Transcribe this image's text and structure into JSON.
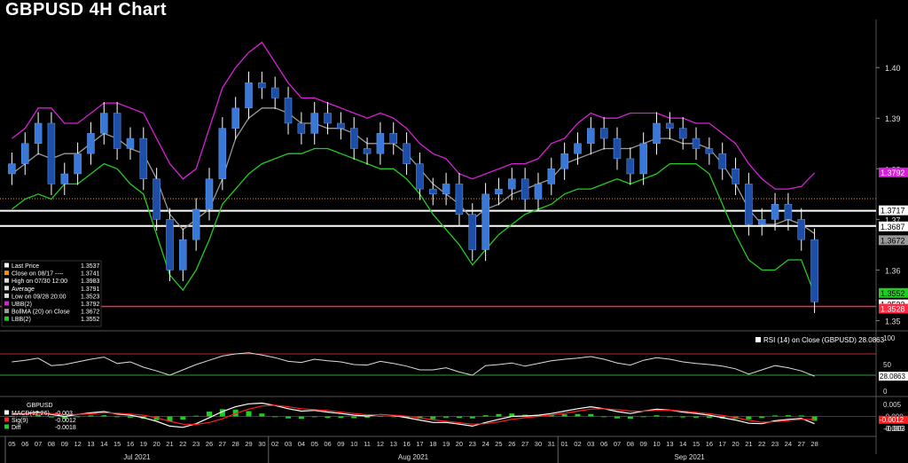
{
  "title": "GBPUSD 4H Chart",
  "colors": {
    "price_up": "#3a78d8",
    "price_wick": "#ffffff",
    "ubb": "#d81fd8",
    "lbb": "#22cc22",
    "bollma": "#9a9a9a",
    "resistance": "#ffffff",
    "support": "#ff2b44",
    "dotted": "#ff8c00",
    "rsi": "#dddddd",
    "macd": "#ffffff",
    "signal": "#ff2020",
    "diff": "#22cc22"
  },
  "legend": [
    {
      "label": "Last Price",
      "value": "1.3537",
      "color": "#ffffff"
    },
    {
      "label": "Close on 08/17 ----",
      "value": "1.3741",
      "color": "#ff8c00"
    },
    {
      "label": "High on 07/30 12:00",
      "value": "1.3983",
      "color": "#dddddd"
    },
    {
      "label": "Average",
      "value": "1.3791",
      "color": "#dddddd"
    },
    {
      "label": "Low on 09/28 20:00",
      "value": "1.3523",
      "color": "#dddddd"
    },
    {
      "label": "UBB(2)",
      "value": "1.3792",
      "color": "#d81fd8"
    },
    {
      "label": "BollMA (20)  on Close",
      "value": "1.3672",
      "color": "#9a9a9a"
    },
    {
      "label": "LBB(2)",
      "value": "1.3552",
      "color": "#22cc22"
    }
  ],
  "price_axis": {
    "ticks": [
      "1.40",
      "1.39",
      "1.38",
      "1.37",
      "1.36",
      "1.35"
    ]
  },
  "price_tags": [
    {
      "text": "1.3792",
      "bg": "#d81fd8",
      "fg": "#ffffff"
    },
    {
      "text": "1.3717",
      "bg": "#ffffff",
      "fg": "#000000"
    },
    {
      "text": "1.3687",
      "bg": "#ffffff",
      "fg": "#000000"
    },
    {
      "text": "1.3672",
      "bg": "#9a9a9a",
      "fg": "#000000"
    },
    {
      "text": "1.3552",
      "bg": "#22cc22",
      "fg": "#000000"
    },
    {
      "text": "1.3533",
      "bg": "#ffffff",
      "fg": "#000000"
    },
    {
      "text": "1.3528",
      "bg": "#ff2b44",
      "fg": "#ffffff"
    }
  ],
  "levels": {
    "resistance_1": 1.3717,
    "resistance_2": 1.3687,
    "support": 1.3528,
    "close_0817": 1.3741
  },
  "rsi": {
    "label": "RSI (14)  on Close (GBPUSD) 28.0863",
    "value_tag": "28.0863",
    "ticks": [
      "100",
      "50",
      "0"
    ],
    "overbought": 70,
    "oversold": 30
  },
  "macd": {
    "header": "GBPUSD",
    "rows": [
      {
        "label": "MACD(12,26) ",
        "value": "-0.003",
        "color": "#ffffff"
      },
      {
        "label": "Sig(9)",
        "value": "-0.0012",
        "color": "#ff2020"
      },
      {
        "label": "Diff",
        "value": "-0.0018",
        "color": "#22cc22"
      }
    ],
    "ticks": [
      "0.005",
      "-0.000",
      "-0.005"
    ],
    "tags": [
      "-0.0012",
      "-0.003"
    ]
  },
  "x_axis": {
    "days": [
      "05",
      "06",
      "07",
      "08",
      "09",
      "12",
      "13",
      "14",
      "15",
      "16",
      "19",
      "20",
      "21",
      "22",
      "23",
      "26",
      "27",
      "28",
      "29",
      "30",
      "02",
      "03",
      "04",
      "05",
      "06",
      "09",
      "10",
      "11",
      "12",
      "13",
      "16",
      "17",
      "18",
      "19",
      "20",
      "23",
      "24",
      "25",
      "26",
      "27",
      "30",
      "31",
      "01",
      "02",
      "03",
      "06",
      "07",
      "08",
      "09",
      "10",
      "13",
      "14",
      "15",
      "16",
      "17",
      "20",
      "21",
      "22",
      "23",
      "24",
      "27",
      "28"
    ],
    "months": [
      "Jul 2021",
      "Aug 2021",
      "Sep 2021"
    ]
  },
  "chart_data": {
    "type": "candlestick",
    "title": "GBPUSD 4H Chart",
    "ylim": [
      1.3485,
      1.4095
    ],
    "series": [
      {
        "name": "Price (close)",
        "values": [
          1.381,
          1.385,
          1.389,
          1.377,
          1.379,
          1.383,
          1.387,
          1.391,
          1.384,
          1.386,
          1.378,
          1.37,
          1.36,
          1.366,
          1.372,
          1.378,
          1.388,
          1.392,
          1.397,
          1.396,
          1.394,
          1.389,
          1.387,
          1.391,
          1.389,
          1.388,
          1.384,
          1.383,
          1.387,
          1.385,
          1.381,
          1.376,
          1.375,
          1.377,
          1.371,
          1.364,
          1.375,
          1.376,
          1.378,
          1.374,
          1.377,
          1.38,
          1.383,
          1.385,
          1.388,
          1.386,
          1.382,
          1.379,
          1.385,
          1.389,
          1.388,
          1.386,
          1.384,
          1.383,
          1.38,
          1.377,
          1.369,
          1.37,
          1.373,
          1.37,
          1.366,
          1.3537
        ]
      },
      {
        "name": "UBB(2)",
        "values": [
          1.386,
          1.388,
          1.392,
          1.392,
          1.389,
          1.389,
          1.391,
          1.393,
          1.393,
          1.392,
          1.391,
          1.386,
          1.381,
          1.378,
          1.38,
          1.388,
          1.396,
          1.4,
          1.403,
          1.405,
          1.401,
          1.397,
          1.394,
          1.394,
          1.393,
          1.392,
          1.391,
          1.39,
          1.391,
          1.39,
          1.388,
          1.385,
          1.383,
          1.382,
          1.379,
          1.378,
          1.379,
          1.38,
          1.381,
          1.381,
          1.382,
          1.385,
          1.386,
          1.389,
          1.391,
          1.39,
          1.39,
          1.391,
          1.391,
          1.391,
          1.39,
          1.39,
          1.389,
          1.389,
          1.387,
          1.385,
          1.381,
          1.378,
          1.376,
          1.376,
          1.3765,
          1.3792
        ]
      },
      {
        "name": "BollMA (20)",
        "values": [
          1.379,
          1.381,
          1.383,
          1.382,
          1.383,
          1.383,
          1.385,
          1.387,
          1.386,
          1.384,
          1.383,
          1.378,
          1.371,
          1.368,
          1.37,
          1.372,
          1.378,
          1.386,
          1.39,
          1.392,
          1.392,
          1.391,
          1.389,
          1.389,
          1.388,
          1.388,
          1.387,
          1.385,
          1.385,
          1.385,
          1.383,
          1.38,
          1.377,
          1.375,
          1.373,
          1.37,
          1.372,
          1.373,
          1.375,
          1.376,
          1.377,
          1.378,
          1.381,
          1.382,
          1.383,
          1.384,
          1.384,
          1.384,
          1.385,
          1.386,
          1.386,
          1.385,
          1.385,
          1.384,
          1.381,
          1.377,
          1.372,
          1.369,
          1.369,
          1.37,
          1.369,
          1.3672
        ]
      },
      {
        "name": "LBB(2)",
        "values": [
          1.372,
          1.374,
          1.375,
          1.374,
          1.377,
          1.377,
          1.379,
          1.381,
          1.38,
          1.377,
          1.375,
          1.367,
          1.359,
          1.356,
          1.36,
          1.366,
          1.373,
          1.376,
          1.379,
          1.381,
          1.382,
          1.383,
          1.383,
          1.384,
          1.384,
          1.383,
          1.382,
          1.381,
          1.38,
          1.38,
          1.378,
          1.375,
          1.371,
          1.368,
          1.365,
          1.361,
          1.364,
          1.367,
          1.369,
          1.371,
          1.372,
          1.373,
          1.375,
          1.376,
          1.376,
          1.377,
          1.378,
          1.377,
          1.378,
          1.379,
          1.381,
          1.381,
          1.381,
          1.379,
          1.373,
          1.367,
          1.362,
          1.36,
          1.36,
          1.362,
          1.362,
          1.3552
        ]
      },
      {
        "name": "RSI (14)",
        "values": [
          55,
          58,
          62,
          48,
          50,
          55,
          60,
          64,
          52,
          55,
          45,
          38,
          30,
          40,
          50,
          58,
          66,
          70,
          72,
          68,
          63,
          56,
          54,
          60,
          57,
          55,
          50,
          49,
          56,
          52,
          47,
          40,
          40,
          44,
          36,
          30,
          48,
          50,
          53,
          47,
          52,
          57,
          60,
          62,
          65,
          60,
          53,
          49,
          58,
          63,
          60,
          55,
          52,
          50,
          47,
          42,
          32,
          40,
          48,
          44,
          38,
          28.0863
        ]
      },
      {
        "name": "MACD(12,26)",
        "values": [
          0.001,
          0.0012,
          0.0018,
          0.0008,
          0.0,
          0.0008,
          0.0015,
          0.002,
          0.001,
          0.0005,
          -0.0005,
          -0.002,
          -0.004,
          -0.0045,
          -0.003,
          -0.0005,
          0.002,
          0.004,
          0.0052,
          0.0055,
          0.0045,
          0.0032,
          0.0022,
          0.0025,
          0.0018,
          0.0012,
          0.0005,
          0.0002,
          0.0008,
          0.0004,
          -0.0005,
          -0.0015,
          -0.0025,
          -0.0025,
          -0.0032,
          -0.004,
          -0.0025,
          -0.0012,
          0.0,
          0.0002,
          0.0005,
          0.0012,
          0.0022,
          0.0032,
          0.004,
          0.0032,
          0.002,
          0.0012,
          0.0022,
          0.003,
          0.0026,
          0.0018,
          0.0012,
          0.0005,
          -0.0005,
          -0.0015,
          -0.0028,
          -0.003,
          -0.0018,
          -0.0012,
          -0.0008,
          -0.003
        ]
      },
      {
        "name": "Sig(9)",
        "values": [
          0.0008,
          0.001,
          0.0013,
          0.0012,
          0.0008,
          0.0008,
          0.0011,
          0.0015,
          0.0013,
          0.001,
          0.0005,
          -0.0005,
          -0.002,
          -0.0032,
          -0.0033,
          -0.0025,
          -0.001,
          0.0012,
          0.003,
          0.0043,
          0.0046,
          0.004,
          0.0032,
          0.0028,
          0.0024,
          0.0018,
          0.0012,
          0.0007,
          0.0007,
          0.0005,
          0.0001,
          -0.0006,
          -0.0014,
          -0.002,
          -0.0026,
          -0.0032,
          -0.003,
          -0.0022,
          -0.0012,
          -0.0005,
          0.0,
          0.0006,
          0.0013,
          0.0022,
          0.003,
          0.0032,
          0.0028,
          0.0022,
          0.0022,
          0.0025,
          0.0026,
          0.0022,
          0.0017,
          0.0011,
          0.0004,
          -0.0005,
          -0.0016,
          -0.0024,
          -0.0022,
          -0.0017,
          -0.0012,
          -0.0012
        ]
      }
    ]
  }
}
